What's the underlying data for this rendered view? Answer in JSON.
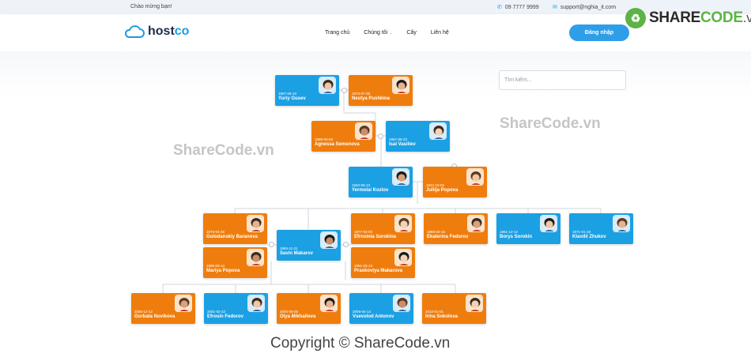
{
  "topbar": {
    "greeting": "Chào mừng bạn!",
    "phone": "09 7777 9999",
    "email": "support@nghia_it.com"
  },
  "sharecode_logo": {
    "brand_prefix": "SHARE",
    "brand_suffix": "CODE",
    "domain": ".vn"
  },
  "nav": {
    "brand_left": "host",
    "brand_right": "co",
    "items": [
      "Trang chủ",
      "Chúng tôi",
      "Cây",
      "Liên hệ"
    ],
    "dropdown_icon": "chevron-down-icon",
    "login_label": "Đăng nhập"
  },
  "search": {
    "placeholder": "Tìm kiếm..."
  },
  "watermarks": [
    "ShareCode.vn",
    "ShareCode.vn"
  ],
  "copyright": "Copyright © ShareCode.vn",
  "colors": {
    "male": "#1ba0e4",
    "female": "#ef7d0d",
    "accent": "#2e9ee8",
    "brand_green": "#5cb346"
  },
  "people": [
    {
      "date": "1907-06-10",
      "name": "Yuriy Gusev",
      "gender": "male"
    },
    {
      "date": "1973-07-08",
      "name": "Nestya Pushkina",
      "gender": "female"
    },
    {
      "date": "1889-03-03",
      "name": "Agnessa Semenova",
      "gender": "female"
    },
    {
      "date": "1967-06-22",
      "name": "Isai Vasiliev",
      "gender": "male"
    },
    {
      "date": "1940-05-13",
      "name": "Yermolai Kozlov",
      "gender": "male"
    },
    {
      "date": "1942-10-02",
      "name": "Juliija Popova",
      "gender": "female"
    },
    {
      "date": "1979-04-26",
      "name": "Golodanskiy Baranova",
      "gender": "female"
    },
    {
      "date": "1984-11-21",
      "name": "Savin Makarov",
      "gender": "male"
    },
    {
      "date": "1977-03-03",
      "name": "Efrosinia Sorokina",
      "gender": "female"
    },
    {
      "date": "1969-03-16",
      "name": "Ekaterina Fedorov",
      "gender": "female"
    },
    {
      "date": "1961-12-12",
      "name": "Borys Sorokin",
      "gender": "male"
    },
    {
      "date": "1971-01-19",
      "name": "Klavdii Zhukov",
      "gender": "male"
    },
    {
      "date": "1998-03-14",
      "name": "Mariya Popova",
      "gender": "female"
    },
    {
      "date": "1961-03-13",
      "name": "Praskoviya Makarova",
      "gender": "female"
    },
    {
      "date": "2006-12-12",
      "name": "Gorbata Novikova",
      "gender": "female"
    },
    {
      "date": "2001-02-22",
      "name": "Efrosin Fedorov",
      "gender": "male"
    },
    {
      "date": "2004-06-03",
      "name": "Olya Mikhailova",
      "gender": "female"
    },
    {
      "date": "2006-04-14",
      "name": "Vsevolod Antonov",
      "gender": "male"
    },
    {
      "date": "2010-01-01",
      "name": "Irina Sokolova",
      "gender": "female"
    }
  ]
}
